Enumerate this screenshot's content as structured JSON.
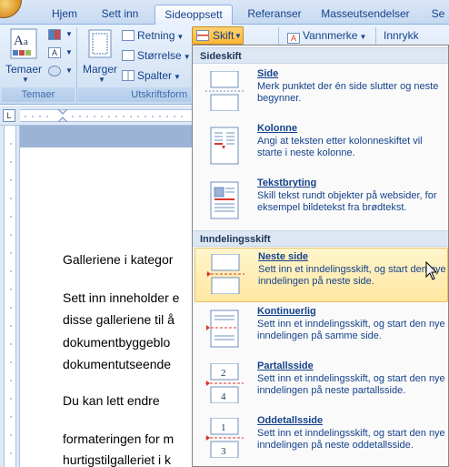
{
  "tabs": [
    {
      "label": "Hjem"
    },
    {
      "label": "Sett inn"
    },
    {
      "label": "Sideoppsett"
    },
    {
      "label": "Referanser"
    },
    {
      "label": "Masseutsendelser"
    },
    {
      "label": "Se"
    }
  ],
  "ribbon": {
    "themes": {
      "label": "Temaer",
      "group_label": "Temaer"
    },
    "margins": {
      "label": "Marger"
    },
    "orientation": {
      "label": "Retning"
    },
    "size": {
      "label": "Størrelse"
    },
    "columns": {
      "label": "Spalter"
    },
    "breaks": {
      "label": "Skift"
    },
    "watermark": {
      "label": "Vannmerke"
    },
    "indent": {
      "label": "Innrykk"
    },
    "page_setup_group": {
      "label": "Utskriftsform"
    }
  },
  "menu": {
    "section1": "Sideskift",
    "section2": "Inndelingsskift",
    "items": [
      {
        "title": "Side",
        "desc": "Merk punktet der én side slutter og neste begynner."
      },
      {
        "title": "Kolonne",
        "desc": "Angi at teksten etter kolonneskiftet vil starte i neste kolonne."
      },
      {
        "title": "Tekstbryting",
        "desc": "Skill tekst rundt objekter på websider, for eksempel bildetekst fra brødtekst."
      },
      {
        "title": "Neste side",
        "desc": "Sett inn et inndelingsskift, og start den nye inndelingen på neste side."
      },
      {
        "title": "Kontinuerlig",
        "desc": "Sett inn et inndelingsskift, og start den nye inndelingen på samme side."
      },
      {
        "title": "Partallsside",
        "desc": "Sett inn et inndelingsskift, og start den nye inndelingen på neste partallsside."
      },
      {
        "title": "Oddetallsside",
        "desc": "Sett inn et inndelingsskift, og start den nye inndelingen på neste oddetallsside."
      }
    ]
  },
  "document": {
    "lines": [
      "Galleriene i kategor",
      "Sett inn inneholder e",
      "disse galleriene til å",
      "dokumentbyggeblo",
      "dokumentutseende",
      "Du kan lett endre",
      "formateringen for m",
      "hurtigstilgalleriet i k"
    ]
  },
  "icons": {
    "break_numbers": [
      "2",
      "4",
      "1",
      "3"
    ]
  },
  "colors": {
    "ribbon_text": "#15428b",
    "hover_bg": "#ffe7a2",
    "accent_red": "#d8362c"
  }
}
